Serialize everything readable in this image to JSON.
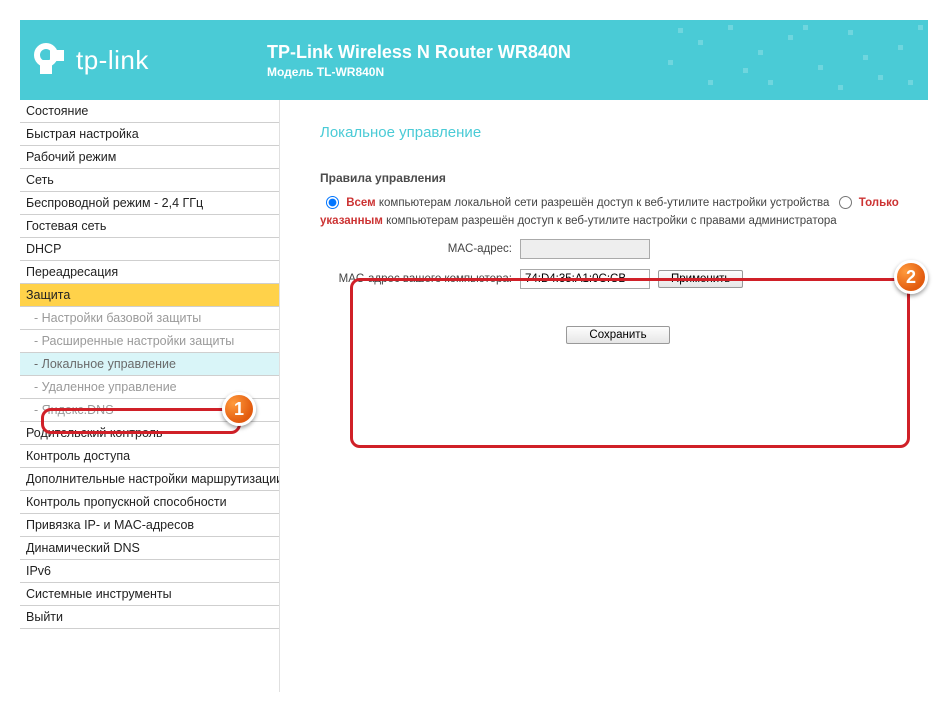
{
  "header": {
    "brand": "tp-link",
    "title": "TP-Link Wireless N Router WR840N",
    "subtitle": "Модель TL-WR840N"
  },
  "sidebar": {
    "items": [
      {
        "label": "Состояние",
        "type": "main"
      },
      {
        "label": "Быстрая настройка",
        "type": "main"
      },
      {
        "label": "Рабочий режим",
        "type": "main"
      },
      {
        "label": "Сеть",
        "type": "main"
      },
      {
        "label": "Беспроводной режим - 2,4 ГГц",
        "type": "main"
      },
      {
        "label": "Гостевая сеть",
        "type": "main"
      },
      {
        "label": "DHCP",
        "type": "main"
      },
      {
        "label": "Переадресация",
        "type": "main"
      },
      {
        "label": "Защита",
        "type": "main",
        "active": true
      },
      {
        "label": "- Настройки базовой защиты",
        "type": "sub"
      },
      {
        "label": "- Расширенные настройки защиты",
        "type": "sub"
      },
      {
        "label": "- Локальное управление",
        "type": "sub",
        "selected": true
      },
      {
        "label": "- Удаленное управление",
        "type": "sub"
      },
      {
        "label": "- Яндекс.DNS",
        "type": "sub"
      },
      {
        "label": "Родительский контроль",
        "type": "main"
      },
      {
        "label": "Контроль доступа",
        "type": "main"
      },
      {
        "label": "Дополнительные настройки маршрутизации",
        "type": "main"
      },
      {
        "label": "Контроль пропускной способности",
        "type": "main"
      },
      {
        "label": "Привязка IP- и MAC-адресов",
        "type": "main"
      },
      {
        "label": "Динамический DNS",
        "type": "main"
      },
      {
        "label": "IPv6",
        "type": "main"
      },
      {
        "label": "Системные инструменты",
        "type": "main"
      },
      {
        "label": "Выйти",
        "type": "main"
      }
    ]
  },
  "content": {
    "page_title": "Локальное управление",
    "panel_heading": "Правила управления",
    "radio_all_strong": "Всем",
    "radio_all_rest": " компьютерам локальной сети разрешён доступ к веб-утилите настройки устройства",
    "radio_only_strong": "Только указанным",
    "radio_only_rest": " компьютерам разрешён доступ к веб-утилите настройки с правами администратора",
    "mac_label": "MAC-адрес:",
    "mac_value": "",
    "your_mac_label": "MAC-адрес вашего компьютера:",
    "your_mac_value": "74:D4:35:A1:0C:CB",
    "apply_btn": "Применить",
    "save_btn": "Сохранить"
  },
  "callouts": {
    "one": "1",
    "two": "2"
  }
}
